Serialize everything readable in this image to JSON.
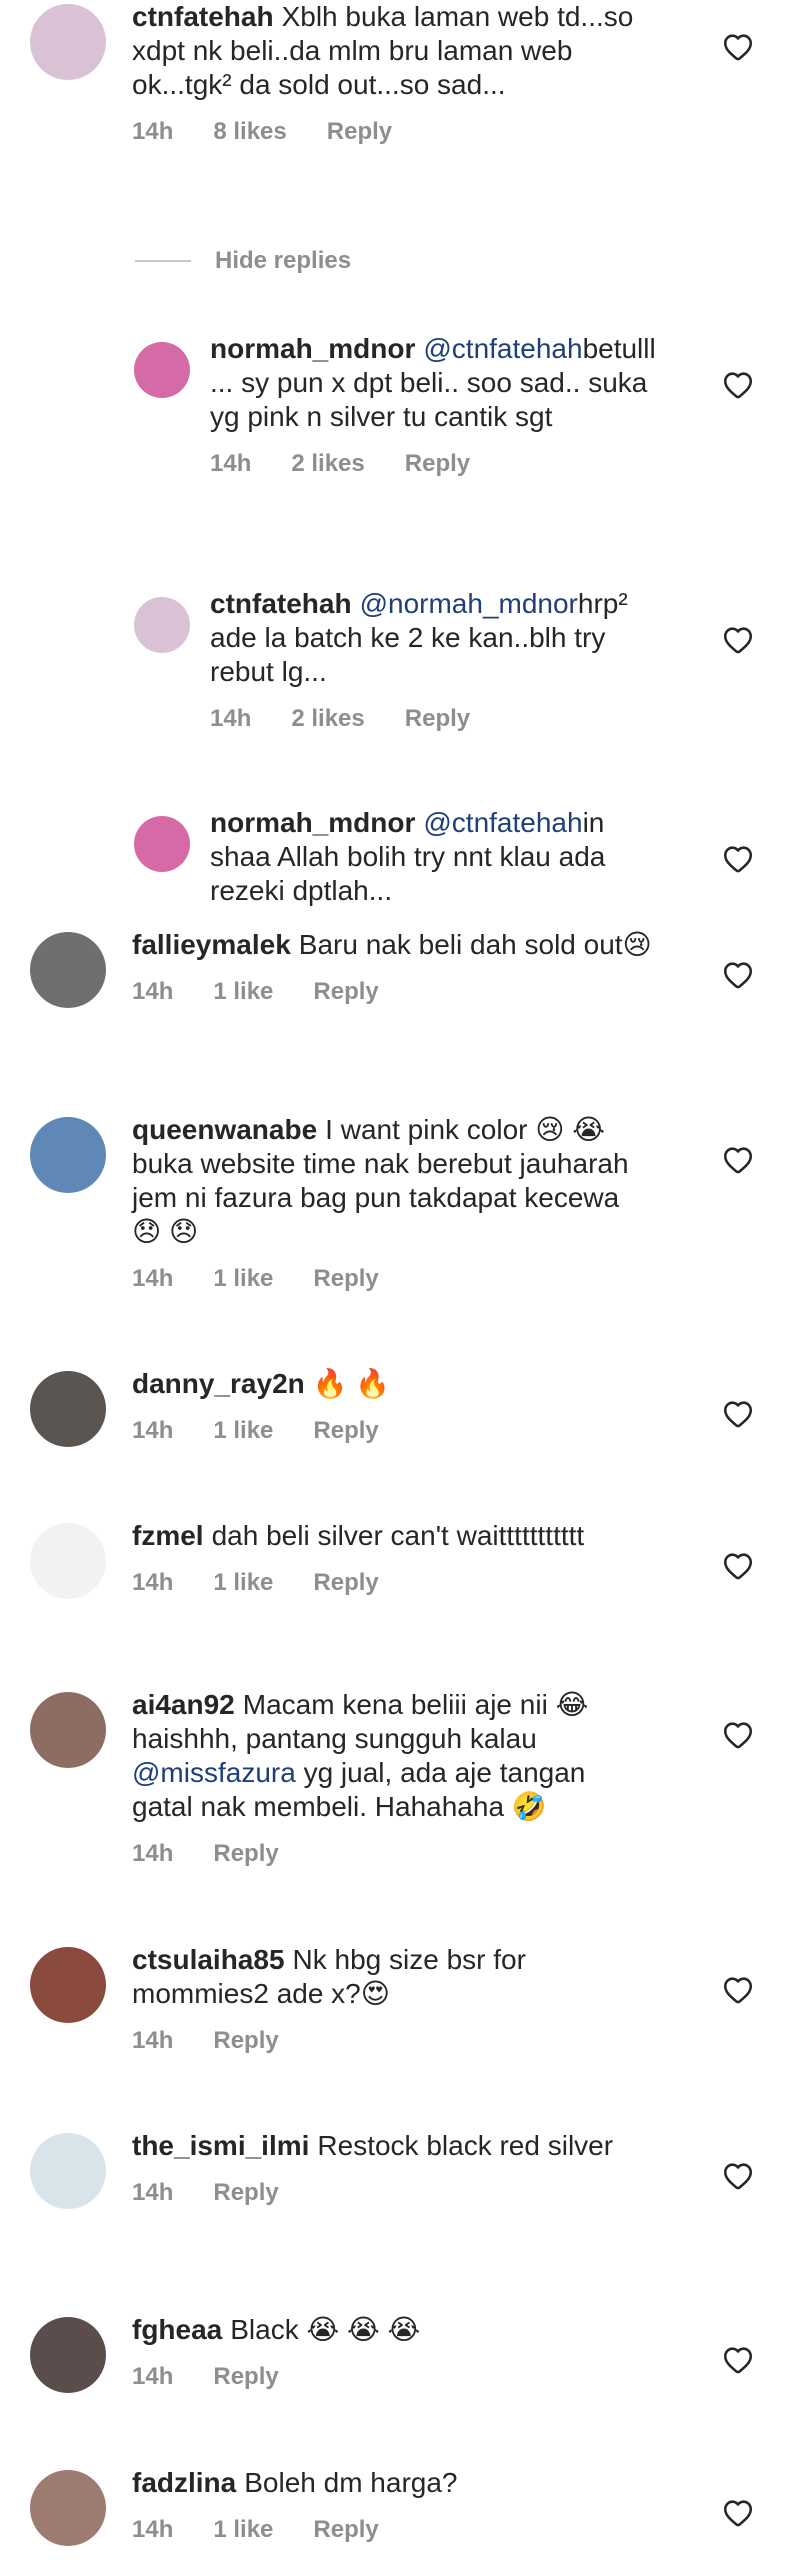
{
  "comments": [
    {
      "user": "ctnfatehah",
      "text": "Xblh buka laman web td...so xdpt nk beli..da mlm bru laman web ok...tgk² da sold out...so sad...",
      "mention": "",
      "time": "14h",
      "likes": "8 likes",
      "reply": "Reply",
      "avatar": "#d9c2d6"
    },
    {
      "user": "normah_mdnor",
      "mention": "@ctnfatehah",
      "text": "betulll... sy pun x dpt beli.. soo sad.. suka yg pink n silver tu cantik sgt",
      "time": "14h",
      "likes": "2 likes",
      "reply": "Reply",
      "avatar": "#d66aa7"
    },
    {
      "user": "ctnfatehah",
      "mention": "@normah_mdnor",
      "text": "hrp² ade la batch ke 2 ke kan..blh try rebut lg...",
      "time": "14h",
      "likes": "2 likes",
      "reply": "Reply",
      "avatar": "#d9c2d6"
    },
    {
      "user": "normah_mdnor",
      "mention": "@ctnfatehah",
      "text": "in shaa Allah bolih try nnt klau ada rezeki dptlah...",
      "time": "",
      "likes": "",
      "reply": "",
      "avatar": "#d66aa7"
    },
    {
      "user": "fallieymalek",
      "text": "Baru nak beli dah sold out😢",
      "mention": "",
      "time": "14h",
      "likes": "1 like",
      "reply": "Reply",
      "avatar": "#6f6f6f"
    },
    {
      "user": "queenwanabe",
      "text": "I want pink color 😢 😭 buka website time nak berebut jauharah jem ni fazura bag pun takdapat kecewa 😞 😞",
      "mention": "",
      "time": "14h",
      "likes": "1 like",
      "reply": "Reply",
      "avatar": "#5f88b6"
    },
    {
      "user": "danny_ray2n",
      "text": "🔥 🔥",
      "mention": "",
      "time": "14h",
      "likes": "1 like",
      "reply": "Reply",
      "avatar": "#5b5552"
    },
    {
      "user": "fzmel",
      "text": "dah beli silver can't waittttttttttt",
      "mention": "",
      "time": "14h",
      "likes": "1 like",
      "reply": "Reply",
      "avatar": "#f2f2f2"
    },
    {
      "user": "ai4an92",
      "text": "Macam kena beliii aje nii 😂 haishhh, pantang sungguh kalau",
      "mention": "@missfazura",
      "text2": "yg jual, ada aje tangan gatal nak membeli. Hahahaha 🤣",
      "time": "14h",
      "likes": "",
      "reply": "Reply",
      "avatar": "#8d6d61"
    },
    {
      "user": "ctsulaiha85",
      "text": "Nk hbg size bsr for mommies2 ade x?😍",
      "mention": "",
      "time": "14h",
      "likes": "",
      "reply": "Reply",
      "avatar": "#8a4a3e"
    },
    {
      "user": "the_ismi_ilmi",
      "text": "Restock black red silver",
      "mention": "",
      "time": "14h",
      "likes": "",
      "reply": "Reply",
      "avatar": "#d8e3ea"
    },
    {
      "user": "fgheaa",
      "text": "Black 😭 😭 😭",
      "mention": "",
      "time": "14h",
      "likes": "",
      "reply": "Reply",
      "avatar": "#5b4d4b"
    },
    {
      "user": "fadzlina",
      "text": "Boleh dm harga?",
      "mention": "",
      "time": "14h",
      "likes": "1 like",
      "reply": "Reply",
      "avatar": "#9e7b70"
    }
  ],
  "hide_replies": "Hide replies",
  "colors": {
    "meta": "#8e8e8e",
    "mention": "#1f3f78",
    "heart": "#262626"
  }
}
